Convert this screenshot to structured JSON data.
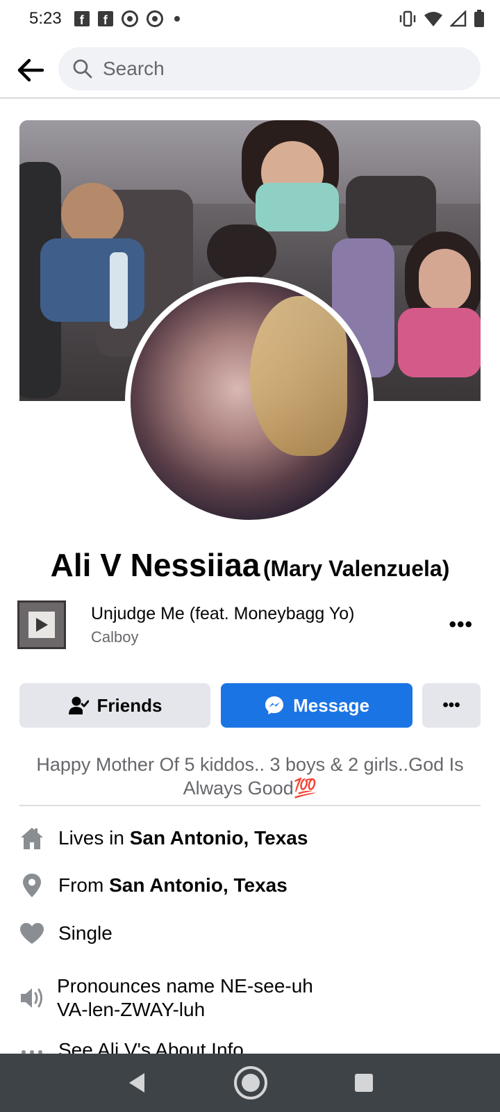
{
  "status_bar": {
    "time": "5:23",
    "left_icons": [
      "facebook-icon",
      "facebook-icon",
      "chrome-icon",
      "chrome-icon",
      "dot-icon"
    ],
    "right_icons": [
      "vibrate-icon",
      "wifi-icon",
      "signal-icon",
      "battery-icon"
    ]
  },
  "search": {
    "placeholder": "Search"
  },
  "profile": {
    "name": "Ali V Nessiiaa",
    "alternate_name": "(Mary Valenzuela)"
  },
  "music": {
    "title": "Unjudge Me (feat. Moneybagg Yo)",
    "artist": "Calboy",
    "more_label": "•••"
  },
  "actions": {
    "friends_label": "Friends",
    "message_label": "Message",
    "more_label": "•••",
    "message_color": "#1b74e4"
  },
  "bio": {
    "text": "Happy Mother Of 5 kiddos.. 3 boys & 2 girls..God Is Always Good💯"
  },
  "intro": {
    "lives_prefix": "Lives in ",
    "lives_place": "San Antonio, Texas",
    "from_prefix": "From ",
    "from_place": "San Antonio, Texas",
    "relationship": "Single",
    "pronounce": "Pronounces name NE-see-uh VA-len-ZWAY-luh",
    "see_about": "See Ali V's About Info"
  }
}
